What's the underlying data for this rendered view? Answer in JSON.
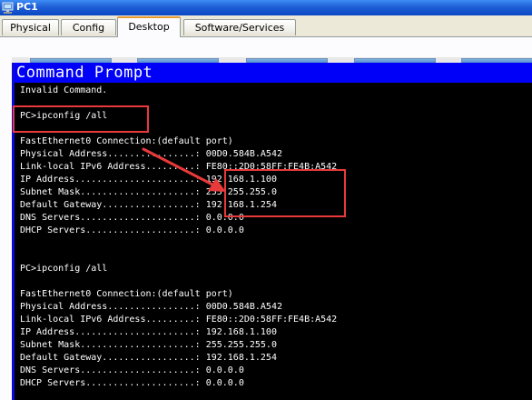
{
  "window": {
    "title": "PC1"
  },
  "tabs": [
    {
      "label": "Physical",
      "active": false
    },
    {
      "label": "Config",
      "active": false
    },
    {
      "label": "Desktop",
      "active": true
    },
    {
      "label": "Software/Services",
      "active": false
    }
  ],
  "command_prompt": {
    "title": "Command Prompt",
    "lines": [
      "Invalid Command.",
      "",
      "PC>ipconfig /all",
      "",
      "FastEthernet0 Connection:(default port)",
      "Physical Address................: 00D0.584B.A542",
      "Link-local IPv6 Address.........: FE80::2D0:58FF:FE4B:A542",
      "IP Address......................: 192.168.1.100",
      "Subnet Mask.....................: 255.255.255.0",
      "Default Gateway.................: 192.168.1.254",
      "DNS Servers.....................: 0.0.0.0",
      "DHCP Servers....................: 0.0.0.0",
      "",
      "",
      "PC>ipconfig /all",
      "",
      "FastEthernet0 Connection:(default port)",
      "Physical Address................: 00D0.584B.A542",
      "Link-local IPv6 Address.........: FE80::2D0:58FF:FE4B:A542",
      "IP Address......................: 192.168.1.100",
      "Subnet Mask.....................: 255.255.255.0",
      "Default Gateway.................: 192.168.1.254",
      "DNS Servers.....................: 0.0.0.0",
      "DHCP Servers....................: 0.0.0.0"
    ]
  },
  "colors": {
    "annotation": "#e8393b",
    "cmd_title_bar": "#0000f8",
    "terminal_bg": "#000000",
    "terminal_fg": "#ffffff"
  },
  "icons": [
    "pc-icon"
  ]
}
